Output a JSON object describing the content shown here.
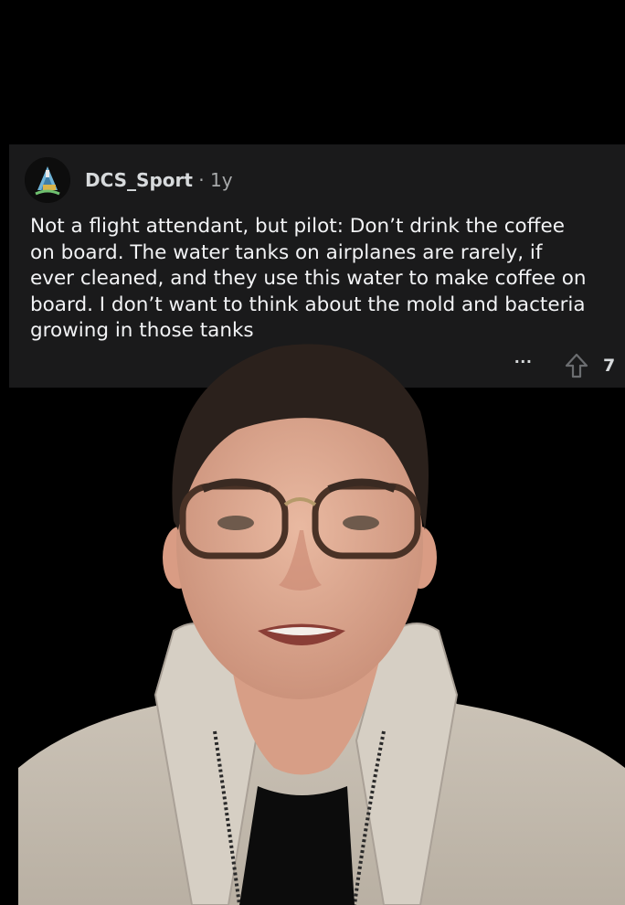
{
  "comment": {
    "username": "DCS_Sport",
    "separator": " · ",
    "age": "1y",
    "lines": [
      "Not a flight attendant, but pilot: Don’t drink the coffee",
      "on board. The water tanks on airplanes are rarely, if",
      "ever cleaned, and they use this water to make coffee on",
      "board. I don’t want to think about the mold and bacteria",
      "growing in those tanks"
    ],
    "more_label": "...",
    "vote_count": "7",
    "icons": {
      "avatar": "avatar-icon",
      "upvote": "upvote-arrow-icon",
      "more": "more-options-icon"
    }
  },
  "colors": {
    "card_bg": "#1a1a1b",
    "page_bg": "#000000",
    "text": "#f2f3f5",
    "muted": "#a8aaab"
  }
}
